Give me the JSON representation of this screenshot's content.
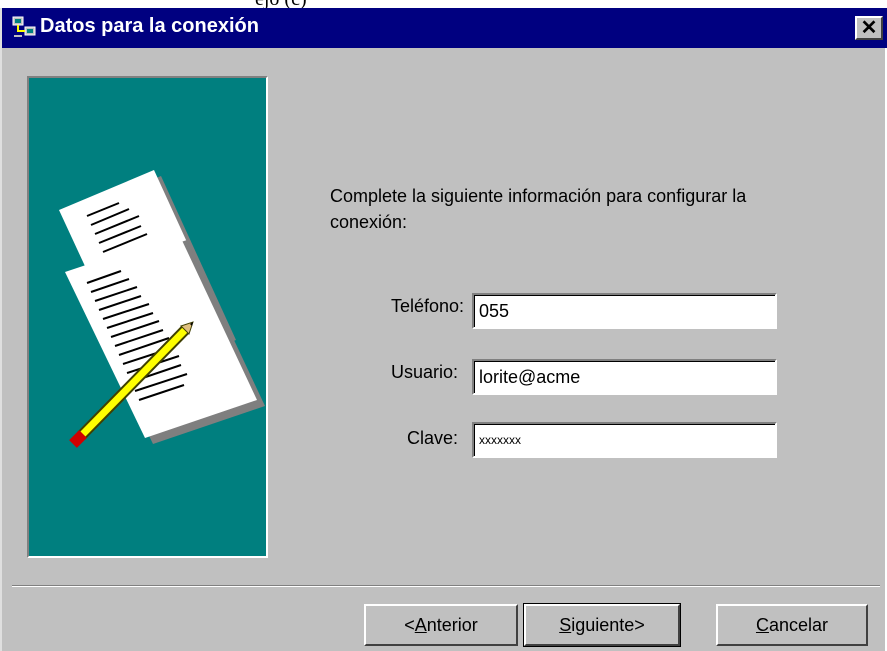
{
  "top_strip_text": "ejo (c)",
  "window": {
    "title": "Datos para la conexión",
    "close_glyph": "✕"
  },
  "instructions": "Complete la siguiente información para configurar la conexión:",
  "fields": {
    "telefono": {
      "label": "Teléfono:",
      "value": "055"
    },
    "usuario": {
      "label": "Usuario:",
      "value": "lorite@acme"
    },
    "clave": {
      "label": "Clave:",
      "value": "xxxxxxx"
    }
  },
  "buttons": {
    "anterior": {
      "prefix": "<",
      "mnemonic": "A",
      "rest": "nterior"
    },
    "siguiente": {
      "mnemonic": "S",
      "rest": "iguiente>"
    },
    "cancelar": {
      "mnemonic": "C",
      "rest": "ancelar"
    }
  },
  "colors": {
    "titlebar": "#000080",
    "panel": "#007f7f",
    "face": "#c0c0c0"
  },
  "icons": {
    "title": "network-computer-icon",
    "illustration": "documents-pencil-illustration"
  }
}
